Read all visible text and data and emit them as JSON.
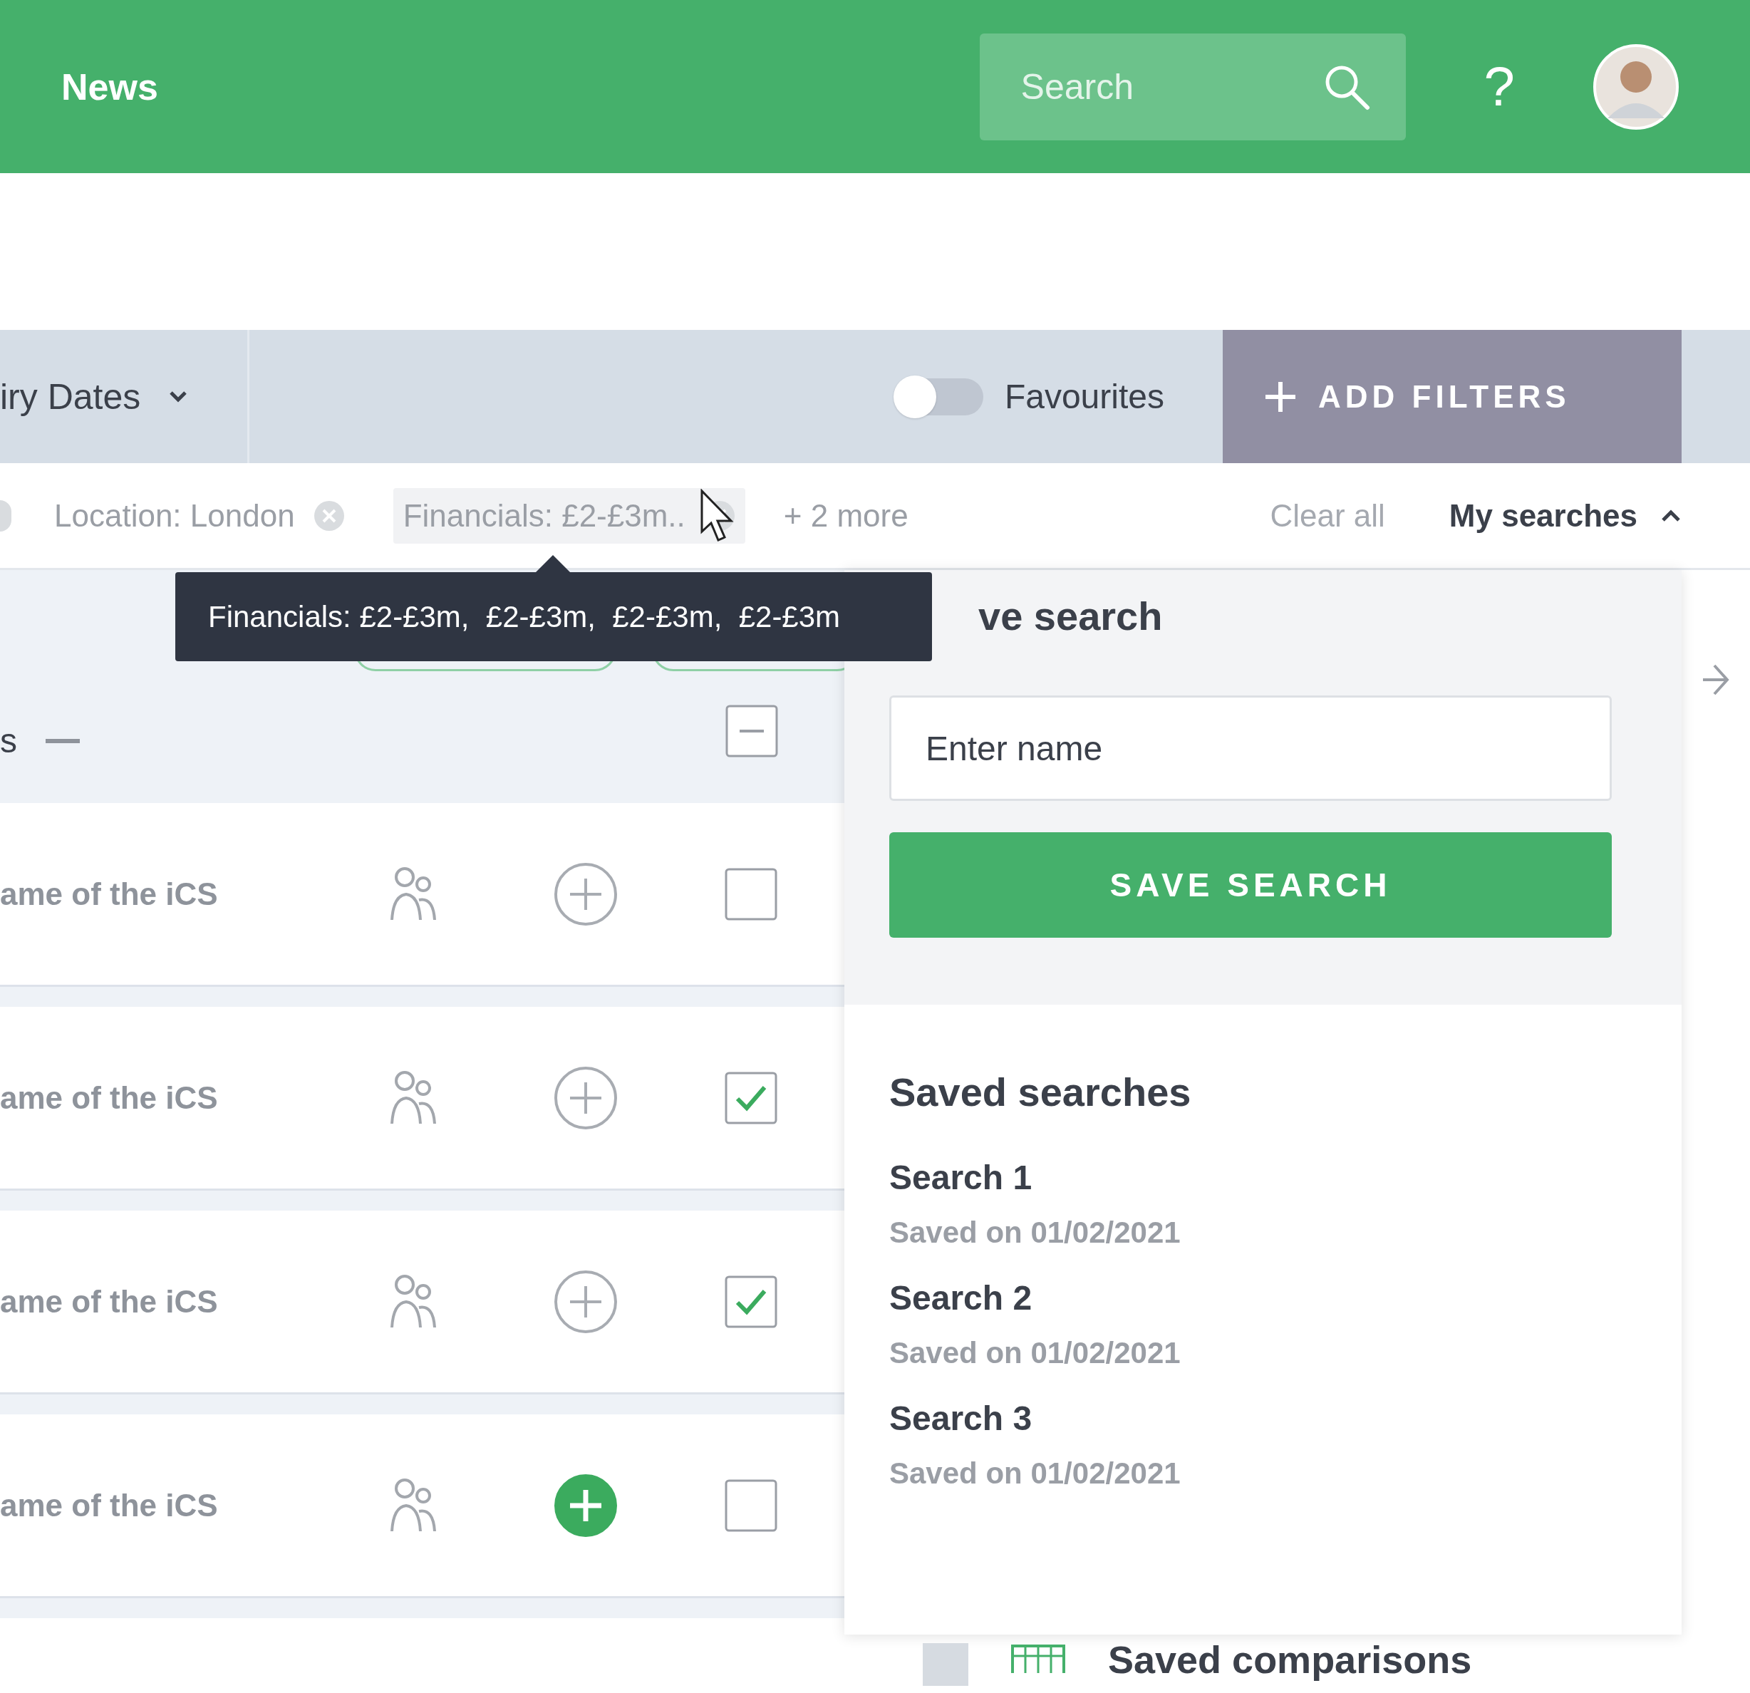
{
  "header": {
    "title": "News",
    "search": {
      "placeholder": "Search"
    },
    "help": "?"
  },
  "filter_bar": {
    "dropdown": "iry Dates",
    "favourites": {
      "label": "Favourites",
      "on": false
    },
    "add_filters": "ADD FILTERS"
  },
  "chips": [
    {
      "label": "Location: London",
      "hovered": false
    },
    {
      "label": "Financials: £2-£3m..",
      "hovered": true
    }
  ],
  "more": "+ 2 more",
  "clear_all": "Clear all",
  "my_searches": {
    "label": "My searches",
    "expanded": true
  },
  "tooltip": "Financials: £2-£3m,  £2-£3m,  £2-£3m,  £2-£3m",
  "table": {
    "header": {
      "label": "s",
      "indeterminate": true
    },
    "rows": [
      {
        "name": "ame of the iCS",
        "added": false,
        "checked": false
      },
      {
        "name": "ame of the iCS",
        "added": false,
        "checked": true
      },
      {
        "name": "ame of the iCS",
        "added": false,
        "checked": true
      },
      {
        "name": "ame of the iCS",
        "added": true,
        "checked": false
      }
    ]
  },
  "panel": {
    "save_title": "ve search",
    "input": {
      "placeholder": "Enter name"
    },
    "save_button": "SAVE SEARCH",
    "saved_title": "Saved searches",
    "saved": [
      {
        "name": "Search 1",
        "date": "Saved on 01/02/2021"
      },
      {
        "name": "Search 2",
        "date": "Saved on 01/02/2021"
      },
      {
        "name": "Search 3",
        "date": "Saved on 01/02/2021"
      }
    ]
  },
  "footer": {
    "saved_comparisons": "Saved comparisons"
  }
}
